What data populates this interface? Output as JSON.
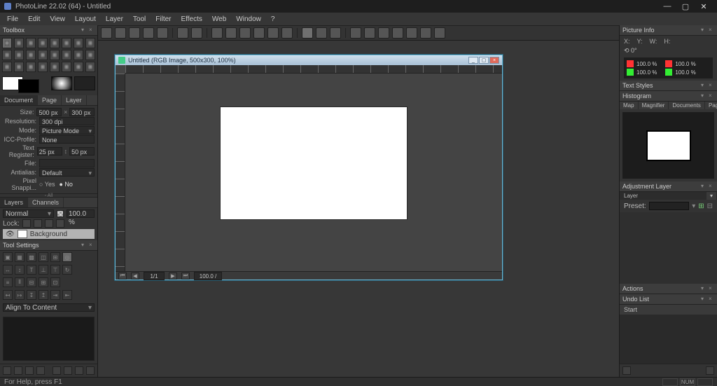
{
  "title": "PhotoLine 22.02 (64) - Untitled",
  "menu": [
    "File",
    "Edit",
    "View",
    "Layout",
    "Layer",
    "Tool",
    "Filter",
    "Effects",
    "Web",
    "Window",
    "?"
  ],
  "panels": {
    "toolbox": "Toolbox",
    "document": "Document",
    "layers": "Layers",
    "toolSettings": "Tool Settings",
    "pictureInfo": "Picture Info",
    "textStyles": "Text Styles",
    "histogram": "Histogram",
    "adjustmentLayer": "Adjustment Layer",
    "actions": "Actions",
    "undoList": "Undo List"
  },
  "doc": {
    "tabs": [
      "Document",
      "Page",
      "Layer"
    ],
    "size_label": "Size:",
    "size_w": "500 px",
    "size_h": "300 px",
    "resolution_label": "Resolution:",
    "resolution": "300 dpi",
    "mode_label": "Mode:",
    "mode": "Picture Mode",
    "icc_label": "ICC-Profile:",
    "icc": "None",
    "text_register_label": "Text Register:",
    "text_reg_a": "25 px",
    "text_reg_b": "50 px",
    "file_label": "File:",
    "antialias_label": "Antialias:",
    "antialias": "Default",
    "snap_label": "Pixel Snappi...",
    "snap_yes": "Yes",
    "snap_no": "No"
  },
  "layers": {
    "tabs": [
      "Layers",
      "Channels"
    ],
    "blend": "Normal",
    "opacity": "100.0 %",
    "lock": "Lock:",
    "bg": "Background"
  },
  "toolSettings": {
    "align": "Align To Content"
  },
  "docwin": {
    "title": "Untitled (RGB Image, 500x300, 100%)",
    "page": "1/1",
    "zoom": "100.0 /"
  },
  "pictureInfo": {
    "labels": [
      "X:",
      "Y:",
      "W:",
      "H:"
    ],
    "angle": "0°",
    "r1": "100.0 %",
    "r2": "100.0 %",
    "g1": "100.0 %",
    "g2": "100.0 %"
  },
  "navTabs": [
    "Map",
    "Magnifier",
    "Documents",
    "Pages"
  ],
  "adjust": {
    "sub": "Layer",
    "preset": "Preset:"
  },
  "undo": {
    "start": "Start"
  },
  "status": {
    "help": "For Help, press F1",
    "num": "NUM"
  },
  "collapse": "All"
}
